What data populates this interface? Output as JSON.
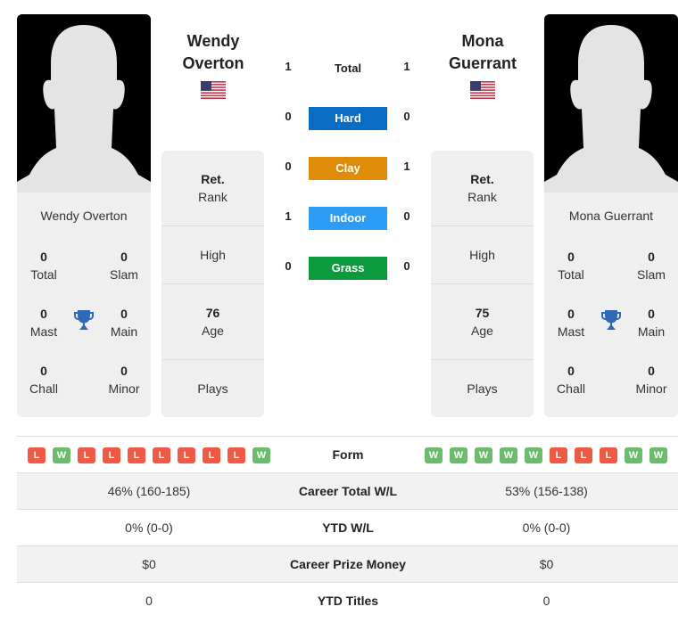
{
  "player1": {
    "name": "Wendy Overton",
    "name_line1": "Wendy",
    "name_line2": "Overton",
    "flag": "us-flag-icon",
    "titles": {
      "total": "0",
      "total_label": "Total",
      "slam": "0",
      "slam_label": "Slam",
      "mast": "0",
      "mast_label": "Mast",
      "main": "0",
      "main_label": "Main",
      "chall": "0",
      "chall_label": "Chall",
      "minor": "0",
      "minor_label": "Minor"
    },
    "info": {
      "rank_value": "Ret.",
      "rank_label": "Rank",
      "high_label": "High",
      "age_value": "76",
      "age_label": "Age",
      "plays_label": "Plays"
    },
    "form": [
      "L",
      "W",
      "L",
      "L",
      "L",
      "L",
      "L",
      "L",
      "L",
      "W"
    ],
    "career_total_wl": "46% (160-185)",
    "ytd_wl": "0% (0-0)",
    "career_prize_money": "$0",
    "ytd_titles": "0"
  },
  "player2": {
    "name": "Mona Guerrant",
    "name_line1": "Mona",
    "name_line2": "Guerrant",
    "flag": "us-flag-icon",
    "titles": {
      "total": "0",
      "total_label": "Total",
      "slam": "0",
      "slam_label": "Slam",
      "mast": "0",
      "mast_label": "Mast",
      "main": "0",
      "main_label": "Main",
      "chall": "0",
      "chall_label": "Chall",
      "minor": "0",
      "minor_label": "Minor"
    },
    "info": {
      "rank_value": "Ret.",
      "rank_label": "Rank",
      "high_label": "High",
      "age_value": "75",
      "age_label": "Age",
      "plays_label": "Plays"
    },
    "form": [
      "W",
      "W",
      "W",
      "W",
      "W",
      "L",
      "L",
      "L",
      "W",
      "W"
    ],
    "career_total_wl": "53% (156-138)",
    "ytd_wl": "0% (0-0)",
    "career_prize_money": "$0",
    "ytd_titles": "0"
  },
  "h2h": {
    "total": {
      "label": "Total",
      "p1": "1",
      "p2": "1"
    },
    "surfaces": [
      {
        "label": "Hard",
        "p1": "0",
        "p2": "0",
        "color": "#0a6cc2"
      },
      {
        "label": "Clay",
        "p1": "0",
        "p2": "1",
        "color": "#e08c0b"
      },
      {
        "label": "Indoor",
        "p1": "1",
        "p2": "0",
        "color": "#2c9cf5"
      },
      {
        "label": "Grass",
        "p1": "0",
        "p2": "0",
        "color": "#0c9b3c"
      }
    ]
  },
  "table": {
    "form_label": "Form",
    "career_total_label": "Career Total W/L",
    "ytd_wl_label": "YTD W/L",
    "prize_label": "Career Prize Money",
    "ytd_titles_label": "YTD Titles"
  }
}
